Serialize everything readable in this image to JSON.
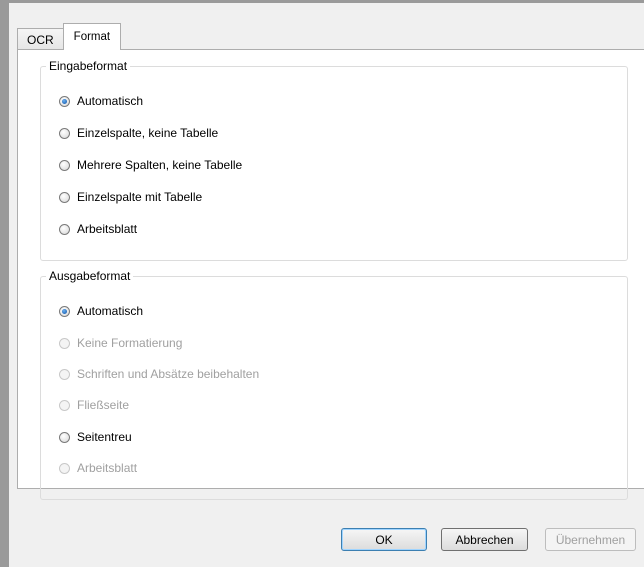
{
  "tabs": [
    {
      "label": "OCR",
      "active": false
    },
    {
      "label": "Format",
      "active": true
    }
  ],
  "input_format": {
    "legend": "Eingabeformat",
    "options": [
      {
        "label": "Automatisch",
        "checked": true,
        "enabled": true
      },
      {
        "label": "Einzelspalte, keine Tabelle",
        "checked": false,
        "enabled": true
      },
      {
        "label": "Mehrere Spalten, keine Tabelle",
        "checked": false,
        "enabled": true
      },
      {
        "label": "Einzelspalte mit Tabelle",
        "checked": false,
        "enabled": true
      },
      {
        "label": "Arbeitsblatt",
        "checked": false,
        "enabled": true
      }
    ]
  },
  "output_format": {
    "legend": "Ausgabeformat",
    "options": [
      {
        "label": "Automatisch",
        "checked": true,
        "enabled": true
      },
      {
        "label": "Keine Formatierung",
        "checked": false,
        "enabled": false
      },
      {
        "label": "Schriften und Absätze beibehalten",
        "checked": false,
        "enabled": false
      },
      {
        "label": "Fließseite",
        "checked": false,
        "enabled": false
      },
      {
        "label": "Seitentreu",
        "checked": false,
        "enabled": true
      },
      {
        "label": "Arbeitsblatt",
        "checked": false,
        "enabled": false
      }
    ]
  },
  "buttons": {
    "ok": "OK",
    "cancel": "Abbrechen",
    "apply": "Übernehmen"
  }
}
